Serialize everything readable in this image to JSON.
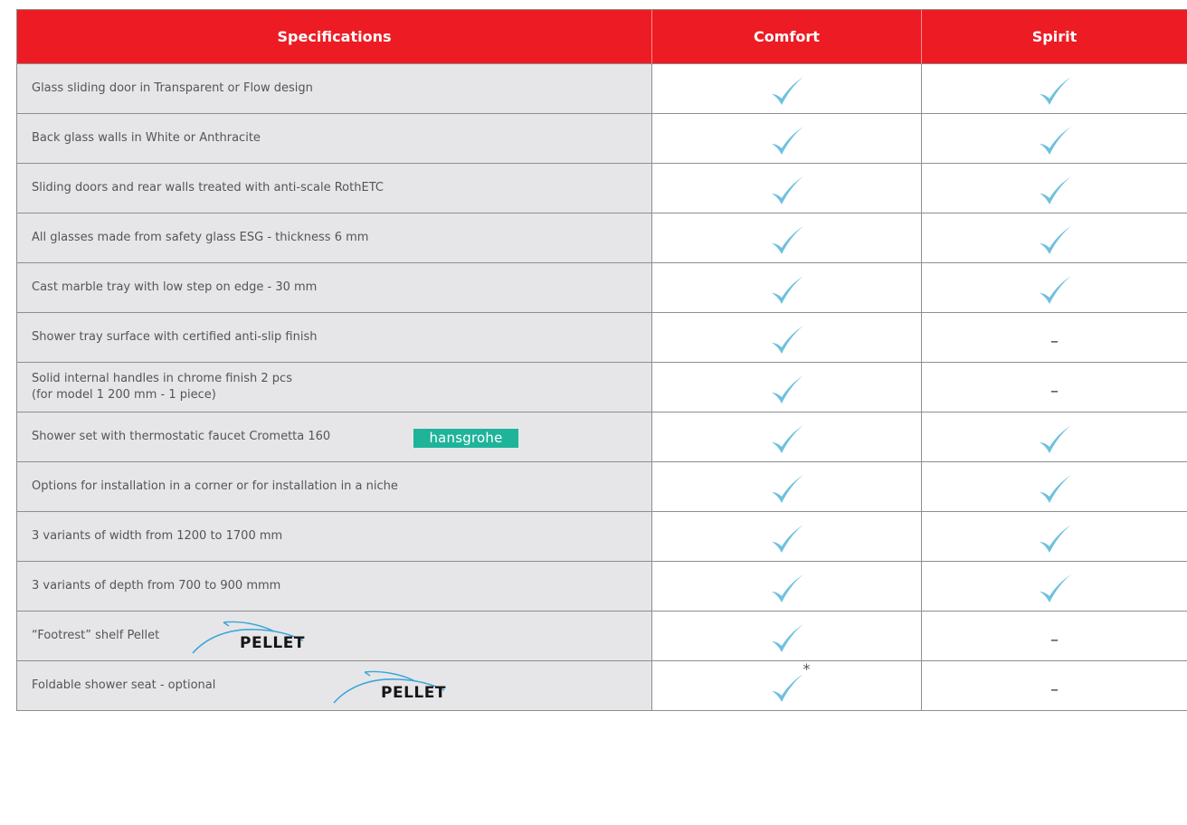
{
  "table": {
    "headers": {
      "specifications": "Specifications",
      "comfort": "Comfort",
      "spirit": "Spirit"
    },
    "rows": [
      {
        "spec": "Glass sliding door in Transparent or Flow design",
        "comfort": "check",
        "spirit": "check"
      },
      {
        "spec": "Back glass walls in White or Anthracite",
        "comfort": "check",
        "spirit": "check"
      },
      {
        "spec": "Sliding doors and rear walls treated with anti-scale RothETC",
        "comfort": "check",
        "spirit": "check"
      },
      {
        "spec": "All glasses made from safety glass ESG - thickness 6 mm",
        "comfort": "check",
        "spirit": "check"
      },
      {
        "spec": "Cast marble tray with low step on edge - 30 mm",
        "comfort": "check",
        "spirit": "check"
      },
      {
        "spec": "Shower tray surface with certified anti-slip finish",
        "comfort": "check",
        "spirit": "–"
      },
      {
        "spec": "Solid internal handles in chrome finish 2 pcs",
        "spec_line2": "(for model 1 200 mm - 1 piece)",
        "comfort": "check",
        "spirit": "–"
      },
      {
        "spec": "Shower set with thermostatic faucet Crometta 160",
        "logo": "hansgrohe",
        "comfort": "check",
        "spirit": "check"
      },
      {
        "spec": "Options for installation in a corner or for installation in a niche",
        "comfort": "check",
        "spirit": "check"
      },
      {
        "spec": "3 variants of width from 1200 to 1700 mm",
        "comfort": "check",
        "spirit": "check"
      },
      {
        "spec": "3 variants of depth from 700 to 900 mmm",
        "comfort": "check",
        "spirit": "check"
      },
      {
        "spec": "“Footrest” shelf Pellet",
        "logo": "PELLET",
        "comfort": "check",
        "spirit": "–"
      },
      {
        "spec": "Foldable shower seat - optional",
        "logo": "PELLET",
        "comfort": "check",
        "comfort_note": "*",
        "spirit": "–"
      }
    ]
  },
  "colors": {
    "header_bg": "#ed1c24",
    "spec_bg": "#e6e6e8",
    "check": "#6ec1dd",
    "hansgrohe": "#1fb39a",
    "border": "#8e8e8e"
  },
  "icons": {
    "available": "checkmark-icon",
    "unavailable": "dash"
  }
}
